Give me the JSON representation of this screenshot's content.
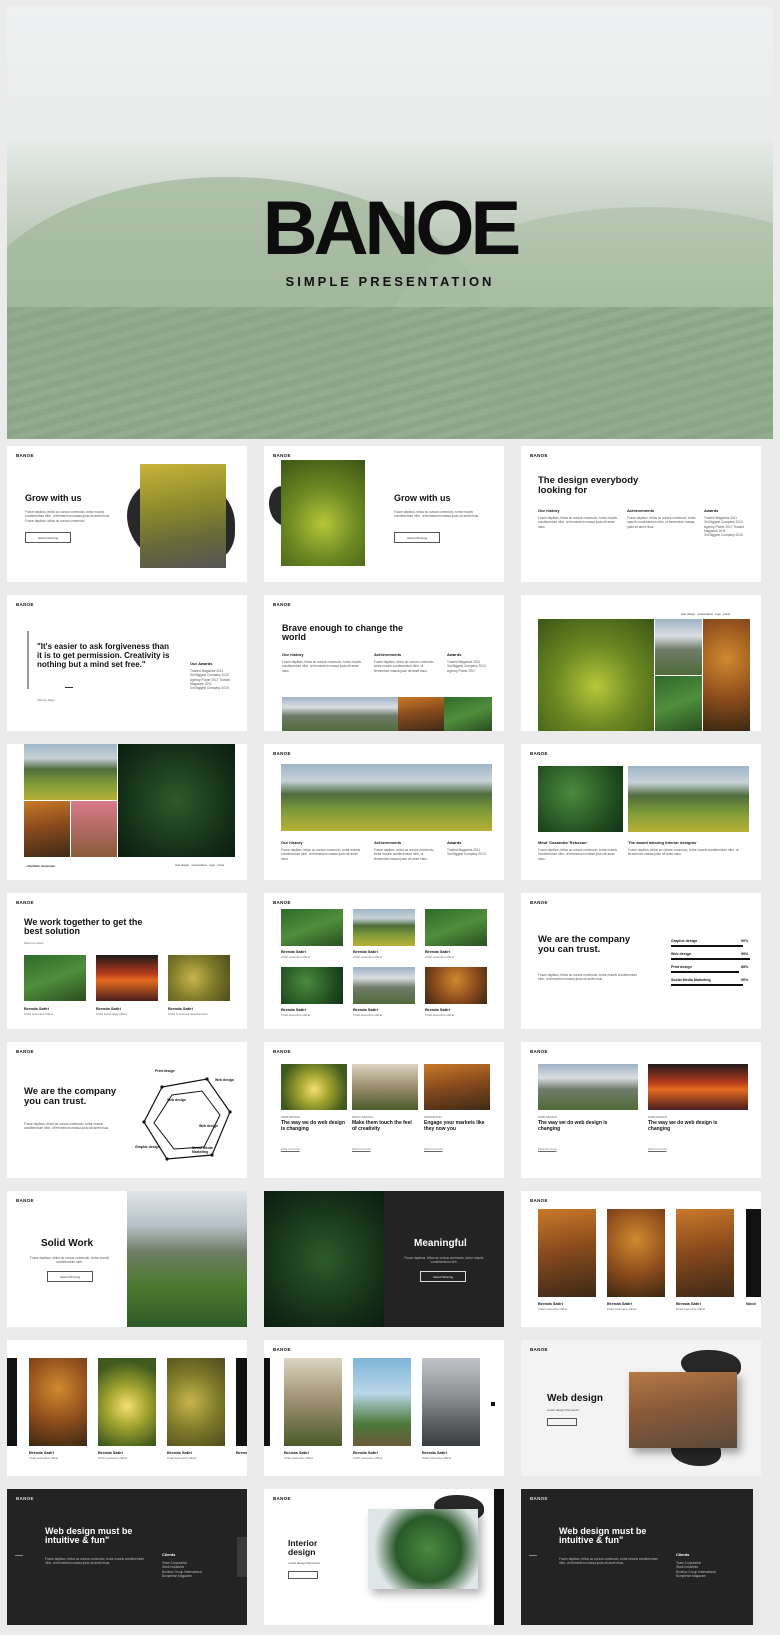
{
  "hero": {
    "title": "BANOE",
    "subtitle": "SIMPLE PRESENTATION"
  },
  "brand": "BANOE",
  "s1": {
    "title": "Grow with us",
    "body": "Fusce dapibus, tellus ac cursus commodo, tortor mauris condimentum nibh, ut fermentum massa justo sit amet risus. Fusce dapibus, tellus ac cursus commodo.",
    "button": "Award Winning"
  },
  "s2": {
    "title": "Grow with us",
    "body": "Fusce dapibus, tellus ac cursus commodo, tortor mauris condimentum nibh, ut fermentum massa justo sit amet risus.",
    "button": "Award Winning"
  },
  "s3": {
    "title": "The design everybody looking for",
    "cols": [
      "Our history",
      "Achievements",
      "Awards"
    ],
    "body": "Fusce dapibus, tellus ac cursus commodo, tortor mauris condimentum nibh, ut fermentum massa justo sit amet risus.",
    "awards": [
      "Trusted Magazine 2011",
      "3rd Biggest Company 2013",
      "Agency Power 2017 Trusted",
      "Magazine 2011",
      "3rd Biggest Company 2015"
    ]
  },
  "s4": {
    "quote": "\"It's easier to ask forgiveness than it is to get permission. Creativity is nothing but a mind set free.\"",
    "author": "Various Days",
    "awards_head": "Our Awards",
    "awards": [
      "Trusted Magazine 2011",
      "3rd Biggest Company 2013",
      "Agency Power 2017 Trusted",
      "Magazine 2011",
      "3rd Biggest Company 2015"
    ]
  },
  "s5": {
    "title": "Brave enough to change the world",
    "cols": [
      "Our history",
      "Achievements",
      "Awards"
    ],
    "body": "Fusce dapibus, tellus ac cursus commodo, tortor mauris condimentum nibh, ut fermentum massa justo sit amet risus.",
    "awards": [
      "Trusted Magazine 2011",
      "3rd Biggest Company 2013",
      "Agency Power 2017"
    ]
  },
  "s6": {
    "caption": "web design · presentation · logo · prints"
  },
  "s7": {
    "caption": "– Portfolio showcase",
    "tags": "web design · presentation · logo · prints"
  },
  "s8": {
    "cols": [
      "Our history",
      "Achievements",
      "Awards"
    ],
    "body": "Fusce dapibus, tellus ac cursus commodo, tortor mauris condimentum nibh, ut fermentum massa justo sit amet risus.",
    "awards": [
      "Trusted Magazine 2011",
      "3rd Biggest Company 2013"
    ]
  },
  "s9": {
    "left": "Mind 'Casandra' Rekoson'",
    "right": "The award winning interior designer",
    "body": "Fusce dapibus, tellus ac cursus commodo, tortor mauris condimentum nibh, ut fermentum massa justo sit amet risus."
  },
  "s10": {
    "title": "We work together to get the best solution",
    "sub": "Meet our team",
    "team": [
      {
        "name": "Brenda Satiri",
        "role": "Chief executive officer"
      },
      {
        "name": "Brenda Satiri",
        "role": "Chief technology officer"
      },
      {
        "name": "Brenda Satiri",
        "role": "Chief in brand & development"
      }
    ]
  },
  "s11": {
    "team": [
      {
        "name": "Brenda Satiri",
        "role": "Chief executive officer"
      },
      {
        "name": "Brenda Satiri",
        "role": "Chief executive officer"
      },
      {
        "name": "Brenda Satiri",
        "role": "Chief executive officer"
      },
      {
        "name": "Brenda Satiri",
        "role": "Chief executive officer"
      },
      {
        "name": "Brenda Satiri",
        "role": "Chief executive officer"
      },
      {
        "name": "Brenda Satiri",
        "role": "Chief executive officer"
      }
    ]
  },
  "s12": {
    "title": "We are the company you can trust.",
    "body": "Fusce dapibus, tellus ac cursus commodo, tortor mauris condimentum nibh, ut fermentum massa justo sit amet risus.",
    "skills": [
      {
        "label": "Graphic design",
        "pct": "90%",
        "v": 0.9
      },
      {
        "label": "Web design",
        "pct": "99%",
        "v": 0.99
      },
      {
        "label": "Print design",
        "pct": "85%",
        "v": 0.85
      },
      {
        "label": "Social Media Marketing",
        "pct": "90%",
        "v": 0.9
      }
    ]
  },
  "s13": {
    "title": "We are the company you can trust.",
    "body": "Fusce dapibus, tellus ac cursus commodo, tortor mauris condimentum nibh, ut fermentum massa justo sit amet risus.",
    "nodes": [
      "Print design",
      "Web design",
      "Web design",
      "Web design",
      "Graphic design",
      "Social Media Marketing"
    ]
  },
  "s14": {
    "items": [
      {
        "kicker": "WEB DESIGN",
        "title": "The way we do web design is changing",
        "more": "Find out more"
      },
      {
        "kicker": "PRINT DESIGN",
        "title": "Make them touch the feel of creativity",
        "more": "Find out more"
      },
      {
        "kicker": "MARKETING",
        "title": "Engage your markets like they now you",
        "more": "Find out more"
      }
    ]
  },
  "s15": {
    "items": [
      {
        "kicker": "WEB DESIGN",
        "title": "The way we do web design is changing",
        "more": "Find out more"
      },
      {
        "kicker": "WEB DESIGN",
        "title": "The way we do web design is changing",
        "more": "Find out more"
      }
    ]
  },
  "s16": {
    "title": "Solid Work",
    "body": "Fusce dapibus, tellus ac cursus commodo, tortor mauris condimentum nibh.",
    "button": "Award Winning"
  },
  "s17": {
    "title": "Meaningful",
    "body": "Fusce dapibus, tellus ac cursus commodo, tortor mauris condimentum nibh.",
    "button": "Award Winning"
  },
  "s18": {
    "team": [
      {
        "name": "Brenda Satiri",
        "role": "Chief executive officer"
      },
      {
        "name": "Brenda Satiri",
        "role": "Chief executive officer"
      },
      {
        "name": "Brenda Satiri",
        "role": "Chief executive officer"
      },
      {
        "name": "Nicol",
        "role": ""
      }
    ]
  },
  "s19": {
    "team": [
      {
        "name": "Brenda Satiri",
        "role": "Chief executive officer"
      },
      {
        "name": "Brenda Satiri",
        "role": "Chief executive officer"
      },
      {
        "name": "Brenda Satiri",
        "role": "Chief executive officer"
      },
      {
        "name": "Brenda Sa",
        "role": ""
      }
    ]
  },
  "s20": {
    "team": [
      {
        "name": "Brenda Satiri",
        "role": "Chief executive officer"
      },
      {
        "name": "Brenda Satiri",
        "role": "Chief executive officer"
      },
      {
        "name": "Brenda Satiri",
        "role": "Chief executive officer"
      }
    ]
  },
  "s21": {
    "title": "Web design",
    "sub": "a web design that works",
    "button": ""
  },
  "s22": {
    "title": "Web design must be intuitive & fun\"",
    "body": "Fusce dapibus, tellus ac cursus commodo, tortor mauris condimentum nibh, ut fermentum massa justo sit amet risus.",
    "clients_head": "Clients",
    "clients": [
      "Team Corporation",
      "Stark Industries",
      "Bombyx Group International",
      "Bumpleton Magazine"
    ]
  },
  "s23": {
    "title": "Interior design",
    "sub": "a web design that works"
  },
  "s24": {
    "title": "Web design must be intuitive & fun\"",
    "body": "Fusce dapibus, tellus ac cursus commodo, tortor mauris condimentum nibh, ut fermentum massa justo sit amet risus.",
    "clients_head": "Clients",
    "clients": [
      "Team Corporation",
      "Stark Industries",
      "Bombyx Group International",
      "Bumpleton Magazine"
    ]
  }
}
